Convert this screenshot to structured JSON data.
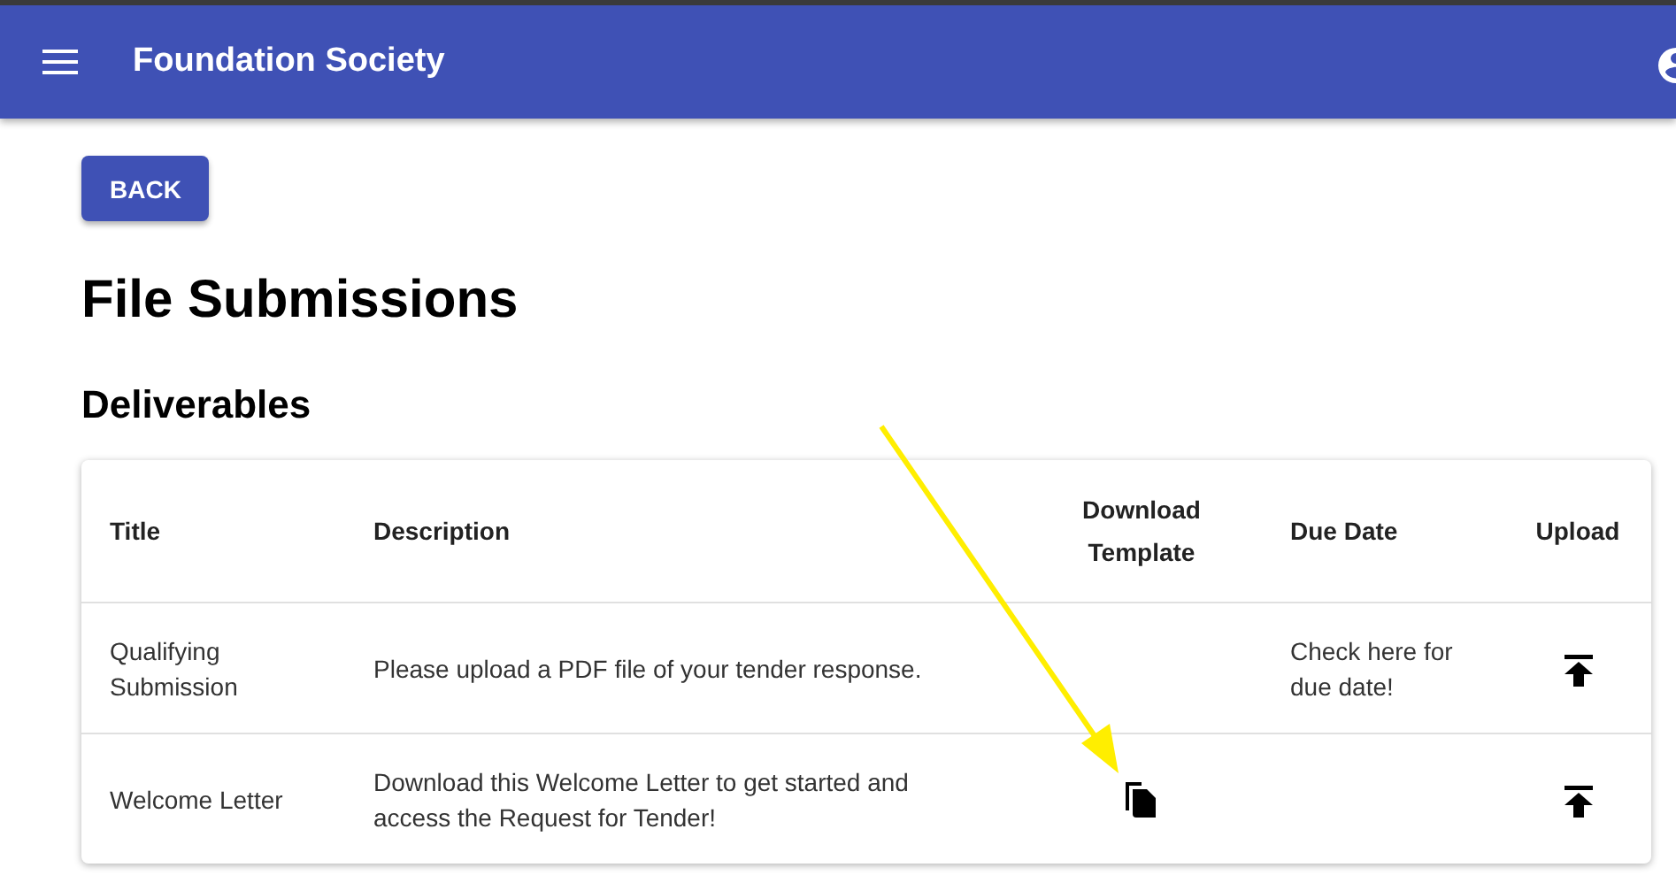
{
  "app_bar": {
    "title": "Foundation Society"
  },
  "back_button": {
    "label": "BACK"
  },
  "page_title": "File Submissions",
  "section_title": "Deliverables",
  "table": {
    "columns": [
      "Title",
      "Description",
      "Download Template",
      "Due Date",
      "Upload"
    ],
    "rows": [
      {
        "title": "Qualifying Submission",
        "description": "Please upload a PDF file of your tender response.",
        "template_available": false,
        "due_date": "Check here for due date!",
        "upload_available": true
      },
      {
        "title": "Welcome Letter",
        "description": "Download this Welcome Letter to get started and access the Request for Tender!",
        "template_available": true,
        "due_date": "",
        "upload_available": true
      }
    ]
  },
  "annotation": {
    "kind": "arrow"
  }
}
